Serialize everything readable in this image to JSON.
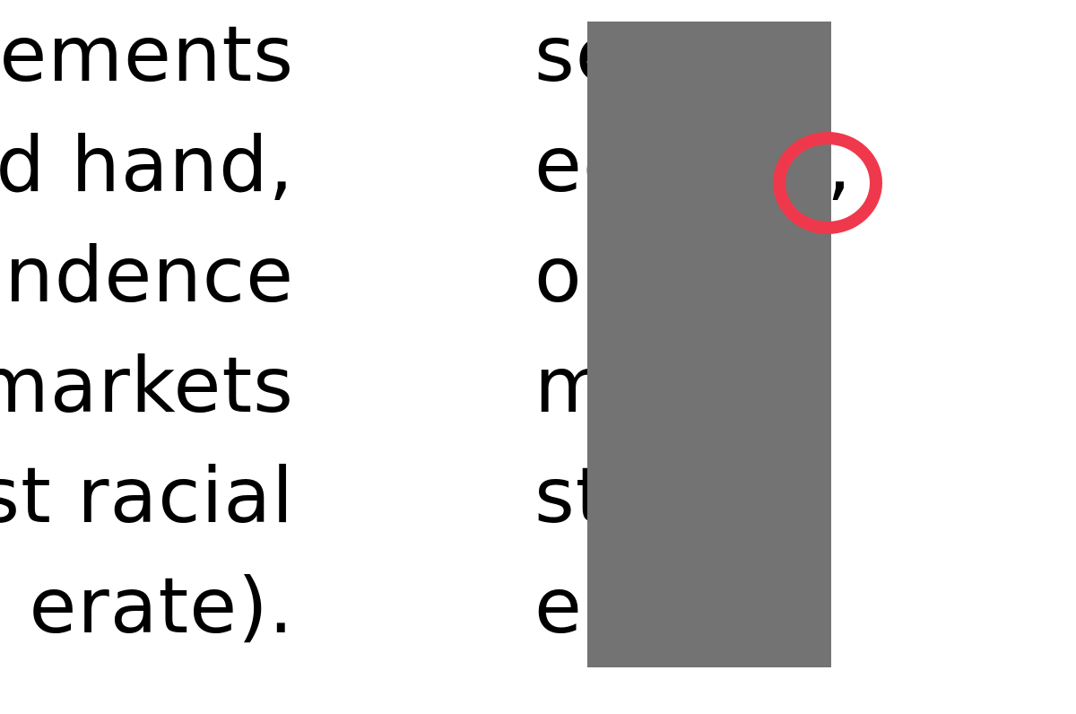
{
  "left_column": {
    "lines": [
      "sements",
      "ed hand,",
      "ondence",
      "markets",
      "st racial",
      "erate)."
    ]
  },
  "right_column": {
    "visible_fragments": [
      "se",
      "ed",
      "or",
      "m",
      "st",
      "er"
    ],
    "trailing_comma": ","
  },
  "colors": {
    "text": "#000000",
    "redaction": "#737373",
    "annotation": "#f0384c",
    "background": "#ffffff"
  }
}
